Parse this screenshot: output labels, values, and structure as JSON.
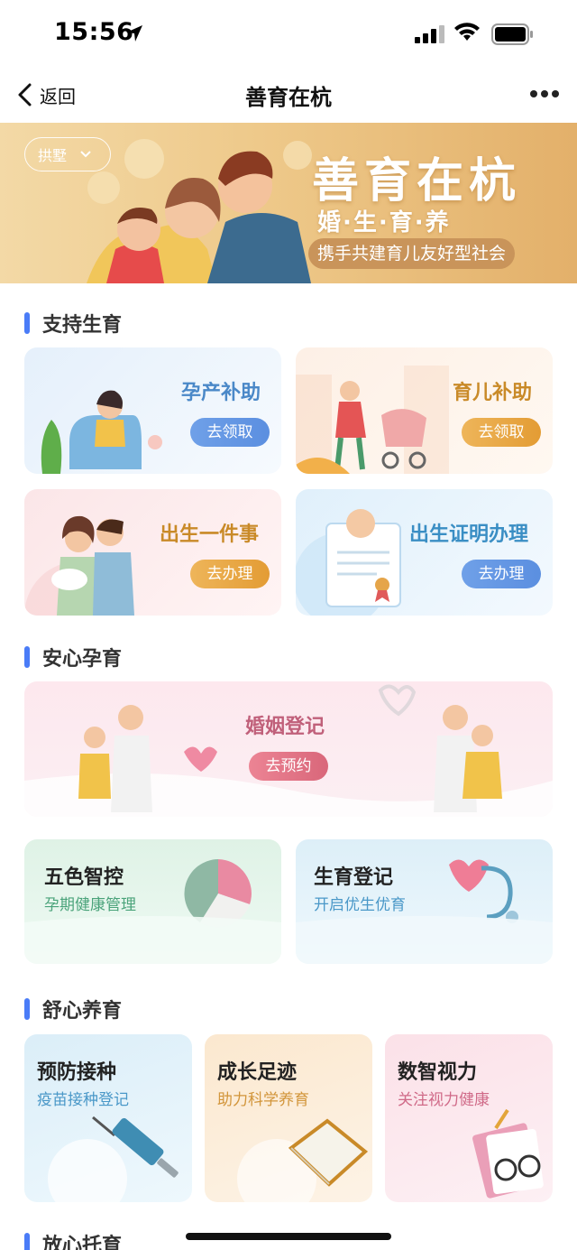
{
  "status_bar": {
    "time": "15:56"
  },
  "nav": {
    "back_label": "返回",
    "title": "善育在杭"
  },
  "banner": {
    "region": "拱墅",
    "title": "善育在杭",
    "subtitle": "婚·生·育·养",
    "slogan": "携手共建育儿友好型社会"
  },
  "sections": [
    {
      "title": "支持生育"
    },
    {
      "title": "安心孕育"
    },
    {
      "title": "舒心养育"
    },
    {
      "title": "放心托育"
    }
  ],
  "support": [
    {
      "title": "孕产补助",
      "button": "去领取"
    },
    {
      "title": "育儿补助",
      "button": "去领取"
    },
    {
      "title": "出生一件事",
      "button": "去办理"
    },
    {
      "title": "出生证明办理",
      "button": "去办理"
    }
  ],
  "pregnancy": {
    "marriage": {
      "title": "婚姻登记",
      "button": "去预约"
    },
    "wuse": {
      "title": "五色智控",
      "subtitle": "孕期健康管理"
    },
    "birth_reg": {
      "title": "生育登记",
      "subtitle": "开启优生优育"
    }
  },
  "raising": [
    {
      "title": "预防接种",
      "subtitle": "疫苗接种登记"
    },
    {
      "title": "成长足迹",
      "subtitle": "助力科学养育"
    },
    {
      "title": "数智视力",
      "subtitle": "关注视力健康"
    }
  ],
  "colors": {
    "accent": "#4a7cf7",
    "blue_btn": "#5b8fe0",
    "orange_btn": "#e9a23b",
    "pink_btn": "#e06e7e"
  }
}
